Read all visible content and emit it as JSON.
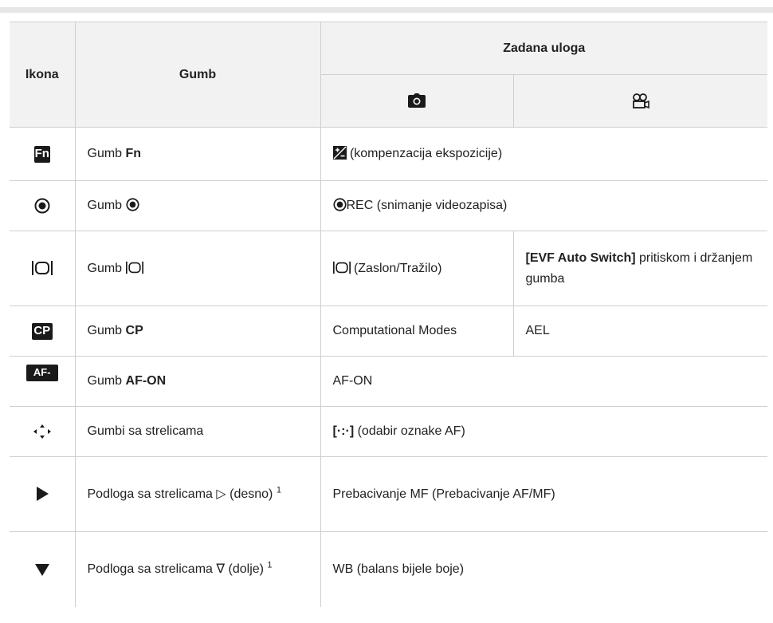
{
  "header": {
    "icon_col": "Ikona",
    "button_col": "Gumb",
    "default_role": "Zadana uloga",
    "photo_icon": "camera-icon",
    "movie_icon": "movie-camera-icon"
  },
  "rows": [
    {
      "icon": "Fn",
      "btn_prefix": "Gumb ",
      "btn_bold": "Fn",
      "role": "(kompenzacija ekspozicije)"
    },
    {
      "icon": "record-icon",
      "btn_prefix": "Gumb ",
      "role": "REC (snimanje videozapisa)"
    },
    {
      "icon": "display-switch-icon",
      "btn_prefix": "Gumb ",
      "role_photo": "(Zaslon/Tražilo)",
      "role_movie_bold": "[EVF Auto Switch]",
      "role_movie": " pritiskom i držanjem gumba"
    },
    {
      "icon": "CP",
      "btn_prefix": "Gumb ",
      "btn_bold": "CP",
      "role_photo": "Computational Modes",
      "role_movie": "AEL"
    },
    {
      "icon": "AF-ON",
      "btn_prefix": "Gumb ",
      "btn_bold": "AF-ON",
      "role": "AF-ON"
    },
    {
      "icon": "arrows-icon",
      "button": "Gumbi sa strelicama",
      "role_bold": "[·:·]",
      "role": " (odabir oznake AF)"
    },
    {
      "icon": "play-right-icon",
      "button": "Podloga sa strelicama ▷ (desno) ",
      "sup": "1",
      "role": "Prebacivanje MF (Prebacivanje AF/MF)"
    },
    {
      "icon": "down-triangle-icon",
      "button": "Podloga sa strelicama ∇ (dolje) ",
      "sup": "1",
      "role": "WB (balans bijele boje)"
    }
  ]
}
